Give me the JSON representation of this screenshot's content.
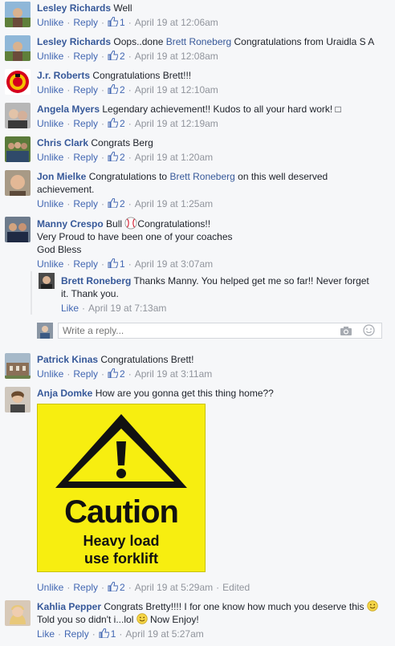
{
  "ui": {
    "like": "Like",
    "unlike": "Unlike",
    "reply": "Reply",
    "write_reply_placeholder": "Write a reply...",
    "link_color": "#365899"
  },
  "comments": [
    {
      "author": "Lesley Richards",
      "text": "Well",
      "action": "Unlike",
      "likes": "1",
      "time": "April 19 at 12:06am"
    },
    {
      "author": "Lesley Richards",
      "text_before": "Oops..done ",
      "tag": "Brett Roneberg",
      "text_after": " Congratulations from Uraidla S A",
      "action": "Unlike",
      "likes": "2",
      "time": "April 19 at 12:08am"
    },
    {
      "author": "J.r. Roberts",
      "text": "Congratulations Brett!!!",
      "action": "Unlike",
      "likes": "2",
      "time": "April 19 at 12:10am"
    },
    {
      "author": "Angela Myers",
      "text": "Legendary achievement!! Kudos to all your hard work! □",
      "action": "Unlike",
      "likes": "2",
      "time": "April 19 at 12:19am"
    },
    {
      "author": "Chris Clark",
      "text": "Congrats Berg",
      "action": "Unlike",
      "likes": "2",
      "time": "April 19 at 1:20am"
    },
    {
      "author": "Jon Mielke",
      "text_before": "Congratulations to ",
      "tag": "Brett Roneberg",
      "text_after": " on this well deserved",
      "text_line2": "achievement.",
      "action": "Unlike",
      "likes": "2",
      "time": "April 19 at 1:25am"
    },
    {
      "author": "Manny Crespo",
      "text_before": "Bull ",
      "text_after": "Congratulations!!",
      "text_line2": "Very Proud to have been one of your coaches",
      "text_line3": "God Bless",
      "action": "Unlike",
      "likes": "1",
      "time": "April 19 at 3:07am"
    },
    {
      "author": "Patrick Kinas",
      "text": "Congratulations Brett!",
      "action": "Unlike",
      "likes": "2",
      "time": "April 19 at 3:11am"
    },
    {
      "author": "Anja Domke",
      "text": "How are you gonna get this thing home??",
      "action": "Unlike",
      "likes": "2",
      "time": "April 19 at 5:29am",
      "edited": "Edited"
    },
    {
      "author": "Kahlia Pepper",
      "text": "Congrats Bretty!!!! I for one know how much you deserve this",
      "text_line2": "Told you so didn't i...lol",
      "text_line2b": "Now Enjoy!",
      "action": "Like",
      "likes": "1",
      "time": "April 19 at 5:27am"
    }
  ],
  "reply": {
    "author": "Brett Roneberg",
    "text": "Thanks Manny. You helped get me so far!! Never forget",
    "text_line2": "it. Thank you.",
    "action": "Like",
    "time": "April 19 at 7:13am"
  },
  "caution_sign": {
    "word": "Caution",
    "line1": "Heavy load",
    "line2": "use forklift",
    "bg_color": "#f7ee10"
  }
}
